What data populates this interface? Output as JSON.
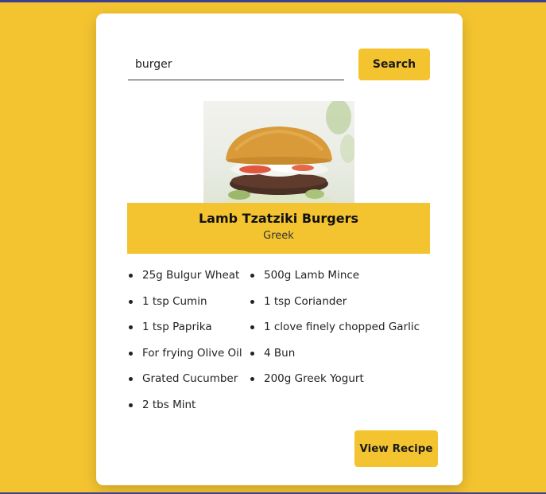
{
  "search": {
    "value": "burger",
    "button_label": "Search"
  },
  "recipe": {
    "title": "Lamb Tzatziki Burgers",
    "cuisine": "Greek",
    "ingredients": [
      "25g Bulgur Wheat",
      "500g Lamb Mince",
      "1 tsp Cumin",
      "1 tsp Coriander",
      "1 tsp Paprika",
      "1 clove finely chopped Garlic",
      "For frying Olive Oil",
      "4 Bun",
      "Grated Cucumber",
      "200g Greek Yogurt",
      "2 tbs Mint"
    ],
    "view_button_label": "View Recipe"
  },
  "colors": {
    "accent": "#f4c430",
    "card": "#ffffff",
    "top_bar": "#3d3f8f"
  }
}
